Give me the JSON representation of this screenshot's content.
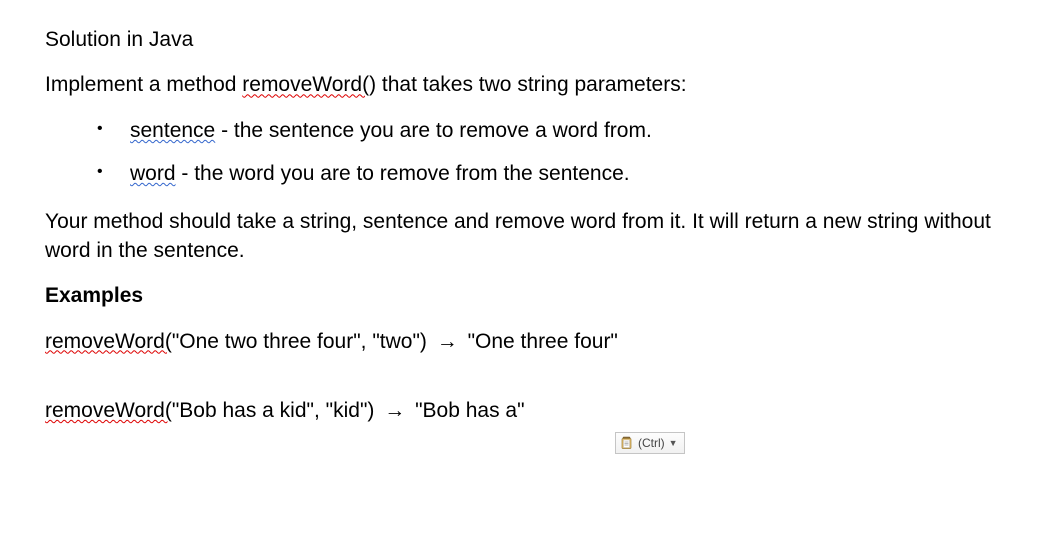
{
  "title": "Solution in Java",
  "intro": {
    "prefix": "Implement a method ",
    "method": "removeWord(",
    "methodSuffix": ")",
    "suffix": " that takes two string parameters:"
  },
  "bullets": [
    {
      "term": "sentence",
      "desc": " - the sentence you are to remove a word from."
    },
    {
      "term": "word",
      "desc": " - the word you are to remove from the sentence."
    }
  ],
  "body": "Your method should take a string, sentence and remove word from it. It will return a new string without word in the sentence.",
  "examplesHeading": "Examples",
  "examples": [
    {
      "call": "removeWord(",
      "args": "\"One two three four\", \"two\") ",
      "arrow": "→",
      "result": " \"One three four\""
    },
    {
      "call": "removeWord(",
      "args": "\"Bob has a kid\", \"kid\") ",
      "arrow": "→",
      "result": " \"Bob has a\""
    }
  ],
  "pasteWidget": {
    "label": "(Ctrl)"
  }
}
